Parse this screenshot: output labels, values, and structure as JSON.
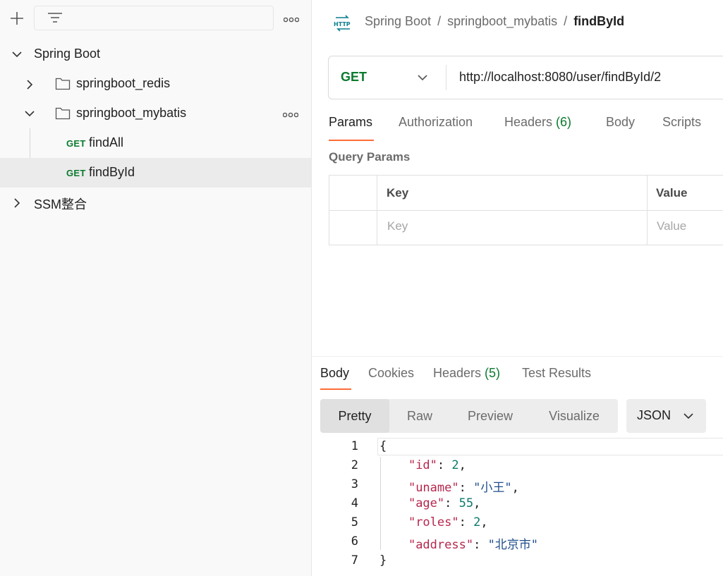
{
  "sidebar": {
    "tree": [
      {
        "label": "Spring Boot"
      },
      {
        "label": "springboot_redis"
      },
      {
        "label": "springboot_mybatis"
      },
      {
        "method": "GET",
        "label": "findAll"
      },
      {
        "method": "GET",
        "label": "findById"
      },
      {
        "label": "SSM整合"
      }
    ]
  },
  "header": {
    "breadcrumb": [
      "Spring Boot",
      "springboot_mybatis",
      "findById"
    ],
    "separator": "/"
  },
  "request": {
    "method": "GET",
    "url": "http://localhost:8080/user/findById/2",
    "tabs": [
      {
        "label": "Params"
      },
      {
        "label": "Authorization"
      },
      {
        "label": "Headers ",
        "count": "(6)"
      },
      {
        "label": "Body"
      },
      {
        "label": "Scripts"
      }
    ],
    "query_params_title": "Query Params",
    "columns": [
      "Key",
      "Value"
    ],
    "placeholders": {
      "key": "Key",
      "value": "Value"
    }
  },
  "response": {
    "tabs": [
      {
        "label": "Body"
      },
      {
        "label": "Cookies"
      },
      {
        "label": "Headers ",
        "count": "(5)"
      },
      {
        "label": "Test Results"
      }
    ],
    "view_options": [
      "Pretty",
      "Raw",
      "Preview",
      "Visualize"
    ],
    "format": "JSON",
    "lines": [
      {
        "n": "1",
        "text": "{"
      },
      {
        "n": "2",
        "key": "\"id\"",
        "value": "2",
        "type": "num",
        "comma": ","
      },
      {
        "n": "3",
        "key": "\"uname\"",
        "value": "\"小王\"",
        "type": "str",
        "comma": ","
      },
      {
        "n": "4",
        "key": "\"age\"",
        "value": "55",
        "type": "num",
        "comma": ","
      },
      {
        "n": "5",
        "key": "\"roles\"",
        "value": "2",
        "type": "num",
        "comma": ","
      },
      {
        "n": "6",
        "key": "\"address\"",
        "value": "\"北京市\"",
        "type": "str",
        "comma": ""
      },
      {
        "n": "7",
        "text": "}"
      }
    ]
  },
  "colors": {
    "accent": "#ff6c37",
    "get_method": "#0b7a2e",
    "json_key": "#b6274e",
    "json_number": "#0b7a6b",
    "json_string": "#1f4e8c"
  }
}
